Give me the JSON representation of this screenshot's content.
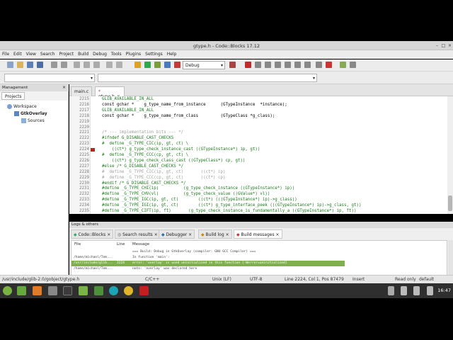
{
  "window": {
    "title": "gtype.h - Code::Blocks 17.12"
  },
  "menu": [
    "File",
    "Edit",
    "View",
    "Search",
    "Project",
    "Build",
    "Debug",
    "Tools",
    "Plugins",
    "Settings",
    "Help"
  ],
  "toolbar": {
    "build_target": "Debug"
  },
  "management": {
    "title": "Management",
    "tab": "Projects",
    "tree": [
      "Workspace",
      "GtkOverlay",
      "Sources"
    ]
  },
  "editor": {
    "tabs": [
      "main.c",
      "gtype.h"
    ],
    "lines": [
      {
        "n": "2215",
        "t": "GLIB_AVAILABLE_IN_ALL",
        "c": "pp"
      },
      {
        "n": "2216",
        "t": "const gchar *    g_type_name_from_instance      (GTypeInstance  *instance);",
        "c": ""
      },
      {
        "n": "2217",
        "t": "GLIB_AVAILABLE_IN_ALL",
        "c": "pp"
      },
      {
        "n": "2218",
        "t": "const gchar *    g_type_name_from_class         (GTypeClass *g_class);",
        "c": ""
      },
      {
        "n": "2219",
        "t": "",
        "c": ""
      },
      {
        "n": "2220",
        "t": "",
        "c": ""
      },
      {
        "n": "2221",
        "t": "/* --- implementation bits --- */",
        "c": "cm"
      },
      {
        "n": "2222",
        "t": "#ifndef G_DISABLE_CAST_CHECKS",
        "c": "pp"
      },
      {
        "n": "2223",
        "t": "#  define _G_TYPE_CIC(ip, gt, ct) \\",
        "c": "pp"
      },
      {
        "n": "2224",
        "t": "    ((ct*) g_type_check_instance_cast ((GTypeInstance*) ip, gt))",
        "c": "pp"
      },
      {
        "n": "2225",
        "t": "#  define _G_TYPE_CCC(cp, gt, ct) \\",
        "c": "pp"
      },
      {
        "n": "2226",
        "t": "    ((ct*) g_type_check_class_cast ((GTypeClass*) cp, gt))",
        "c": "pp"
      },
      {
        "n": "2227",
        "t": "#else /* G_DISABLE_CAST_CHECKS */",
        "c": "pp"
      },
      {
        "n": "2228",
        "t": "#  define _G_TYPE_CIC(ip, gt, ct)       ((ct*) ip)",
        "c": "cm"
      },
      {
        "n": "2229",
        "t": "#  define _G_TYPE_CCC(cp, gt, ct)       ((ct*) cp)",
        "c": "cm"
      },
      {
        "n": "2230",
        "t": "#endif /* G_DISABLE_CAST_CHECKS */",
        "c": "pp"
      },
      {
        "n": "2231",
        "t": "#define _G_TYPE_CHI(ip)          (g_type_check_instance ((GTypeInstance*) ip))",
        "c": "pp"
      },
      {
        "n": "2232",
        "t": "#define _G_TYPE_CHV(vl)          (g_type_check_value ((GValue*) vl))",
        "c": "pp"
      },
      {
        "n": "2233",
        "t": "#define _G_TYPE_IGC(ip, gt, ct)        ((ct*) (((GTypeInstance*) ip)->g_class))",
        "c": "pp"
      },
      {
        "n": "2234",
        "t": "#define _G_TYPE_IGI(ip, gt, ct)        ((ct*) g_type_interface_peek (((GTypeInstance*) ip)->g_class, gt))",
        "c": "pp"
      },
      {
        "n": "2235",
        "t": "#define _G_TYPE_CIFT(ip, ft)       (g_type_check_instance_is_fundamentally_a ((GTypeInstance*) ip, ft))",
        "c": "pp"
      }
    ]
  },
  "logs": {
    "title": "Logs & others",
    "tabs": [
      "Code::Blocks",
      "Search results",
      "Debugger",
      "Build log",
      "Build messages"
    ],
    "columns": [
      "File",
      "Line",
      "Message"
    ],
    "rows": [
      {
        "file": "",
        "line": "",
        "msg": "=== Build: Debug in GtkOverlay (compiler: GNU GCC Compiler) ==="
      },
      {
        "file": "/home/michael/Tem...",
        "line": "",
        "msg": "In function 'main':"
      },
      {
        "file": "/usr/include/glib...",
        "line": "2224",
        "msg": "error: 'overlay' is used uninitialized in this function [-Werror=uninitialized]"
      },
      {
        "file": "/home/michael/Tem...",
        "line": "",
        "msg": "note: 'overlay' was declared here"
      }
    ]
  },
  "status": {
    "path": "/usr/include/glib-2.0/gobject/gtype.h",
    "lang": "C/C++",
    "eol": "Unix (LF)",
    "enc": "UTF-8",
    "pos": "Line 2224, Col 1, Pos 87479",
    "mode": "Insert",
    "access": "Read only",
    "profile": "default"
  },
  "taskbar": {
    "time": "16:47"
  }
}
